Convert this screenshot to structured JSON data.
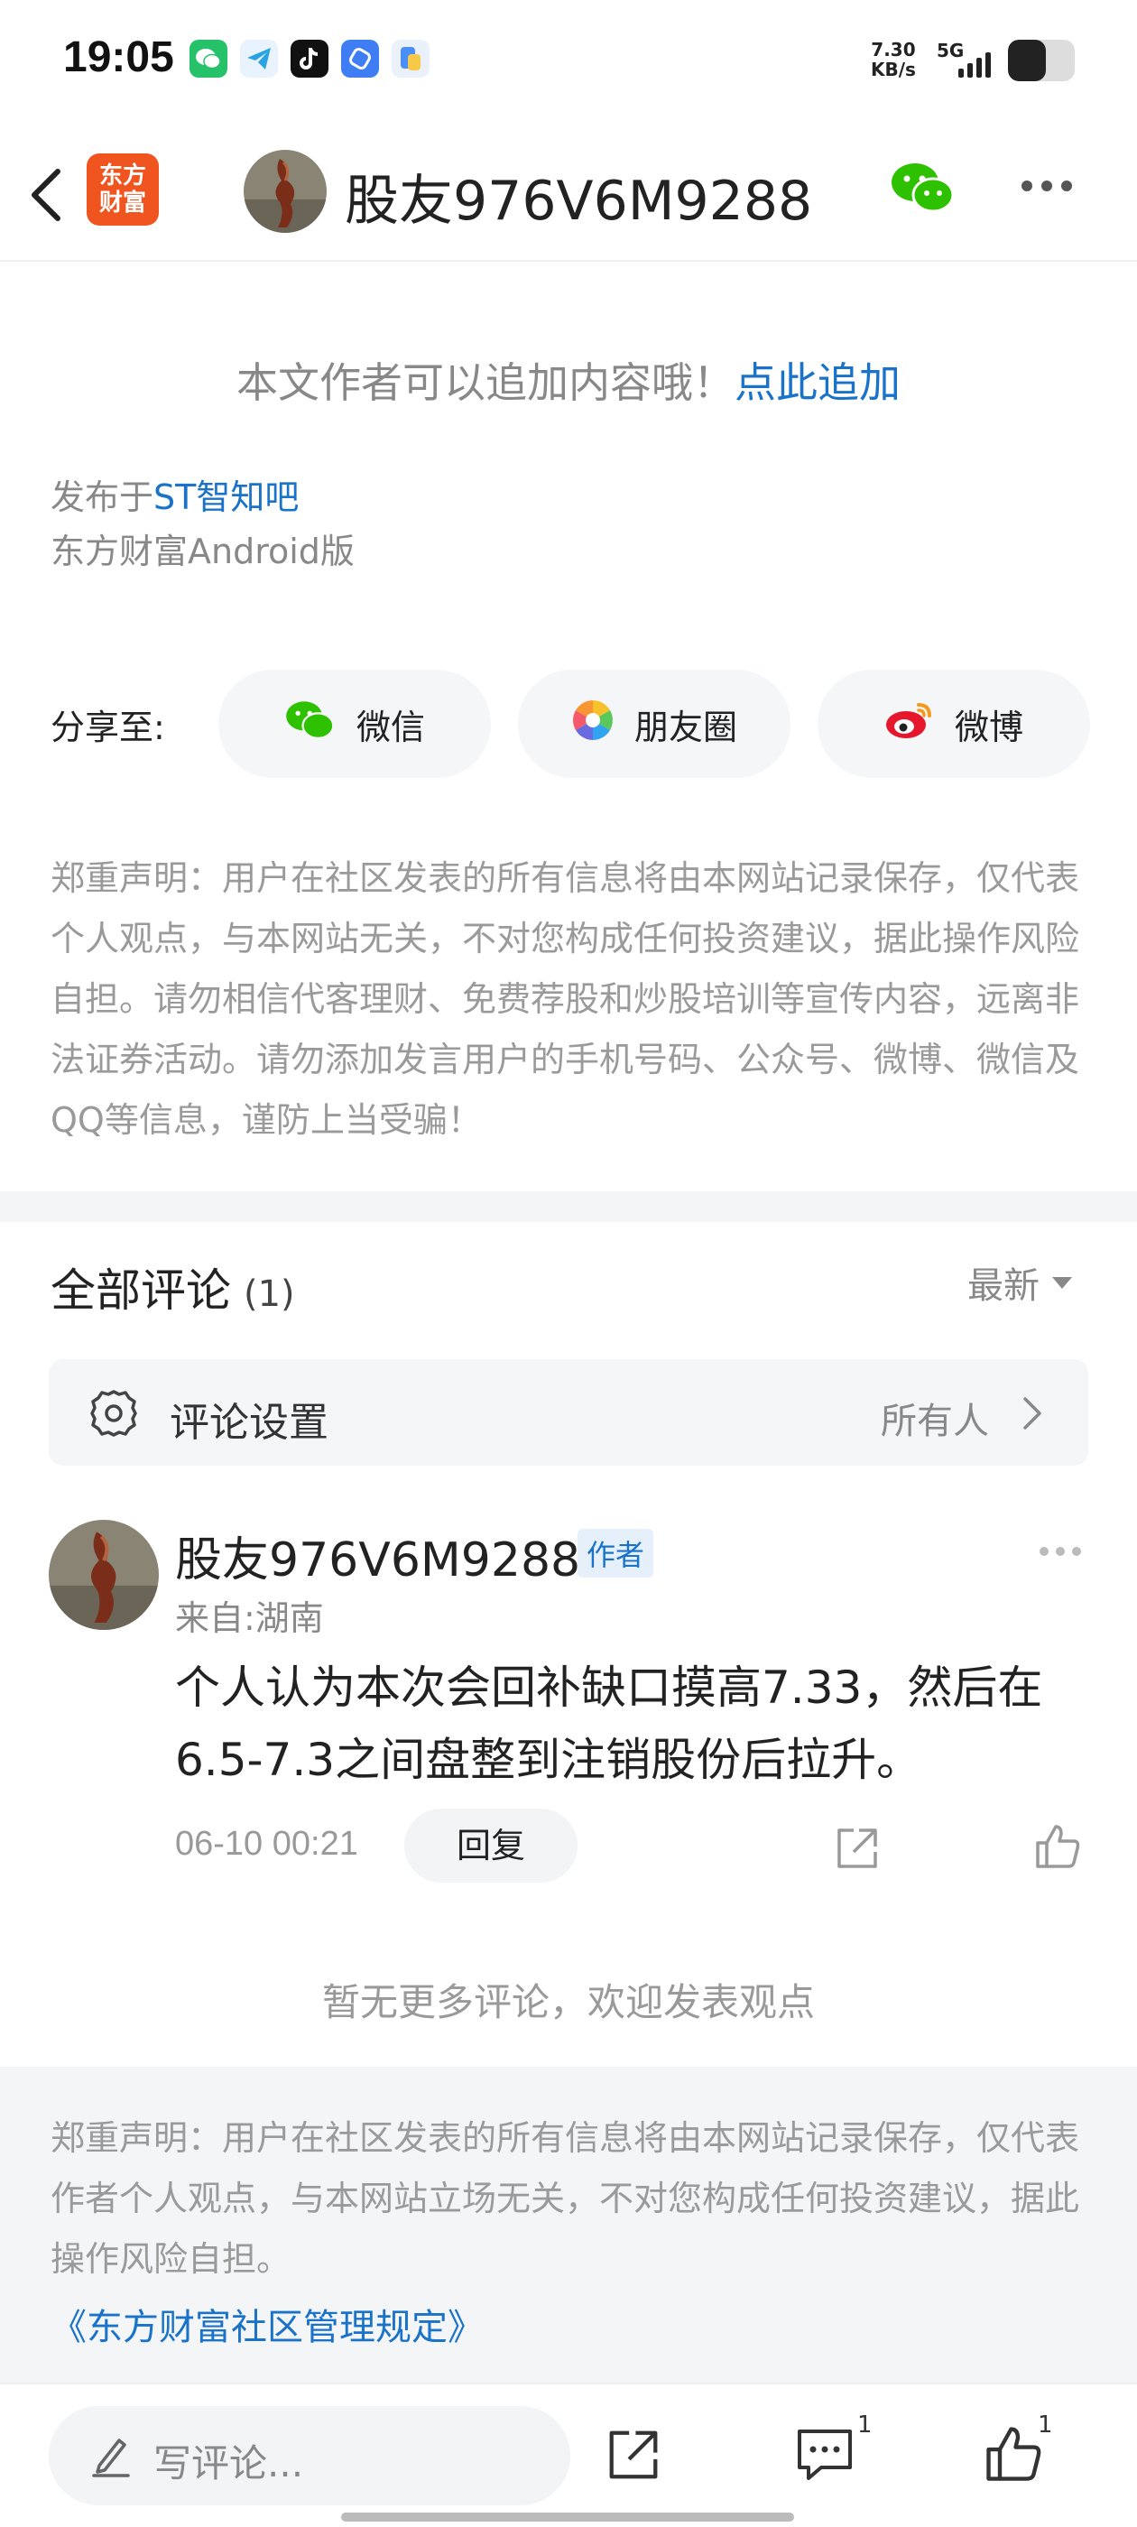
{
  "status_bar": {
    "time": "19:05",
    "net_speed_value": "7.30",
    "net_speed_unit": "KB/s",
    "network": "5G",
    "app_icons": [
      "wechat-icon",
      "telegram-icon",
      "tiktok-icon",
      "browser-icon",
      "files-icon"
    ]
  },
  "header": {
    "logo_line1": "东方",
    "logo_line2": "财富",
    "username": "股友976V6M9288"
  },
  "post": {
    "append_note": "本文作者可以追加内容哦！",
    "append_link": "点此追加",
    "published_prefix": "发布于",
    "published_bar": "ST智知吧",
    "client": "东方财富Android版"
  },
  "share": {
    "label": "分享至:",
    "buttons": [
      {
        "label": "微信",
        "icon": "wechat-icon"
      },
      {
        "label": "朋友圈",
        "icon": "moments-icon"
      },
      {
        "label": "微博",
        "icon": "weibo-icon"
      }
    ]
  },
  "disclaimer": "郑重声明：用户在社区发表的所有信息将由本网站记录保存，仅代表个人观点，与本网站无关，不对您构成任何投资建议，据此操作风险自担。请勿相信代客理财、免费荐股和炒股培训等宣传内容，远离非法证券活动。请勿添加发言用户的手机号码、公众号、微博、微信及QQ等信息，谨防上当受骗！",
  "comments": {
    "title": "全部评论",
    "count": "(1)",
    "sort_label": "最新",
    "settings_label": "评论设置",
    "settings_value": "所有人",
    "items": [
      {
        "username": "股友976V6M9288",
        "badge": "作者",
        "location": "来自:湖南",
        "text": "个人认为本次会回补缺口摸高7.33，然后在6.5-7.3之间盘整到注销股份后拉升。",
        "time": "06-10 00:21",
        "reply_label": "回复"
      }
    ],
    "no_more": "暂无更多评论，欢迎发表观点"
  },
  "bottom_disclaimer": {
    "text": "郑重声明：用户在社区发表的所有信息将由本网站记录保存，仅代表作者个人观点，与本网站立场无关，不对您构成任何投资建议，据此操作风险自担。",
    "rules_link": "《东方财富社区管理规定》"
  },
  "bottom_bar": {
    "comment_placeholder": "写评论...",
    "comment_count": "1",
    "like_count": "1"
  },
  "colors": {
    "link_blue": "#1a73c8",
    "brand_orange": "#f0541f",
    "wechat_green": "#2dc100"
  }
}
